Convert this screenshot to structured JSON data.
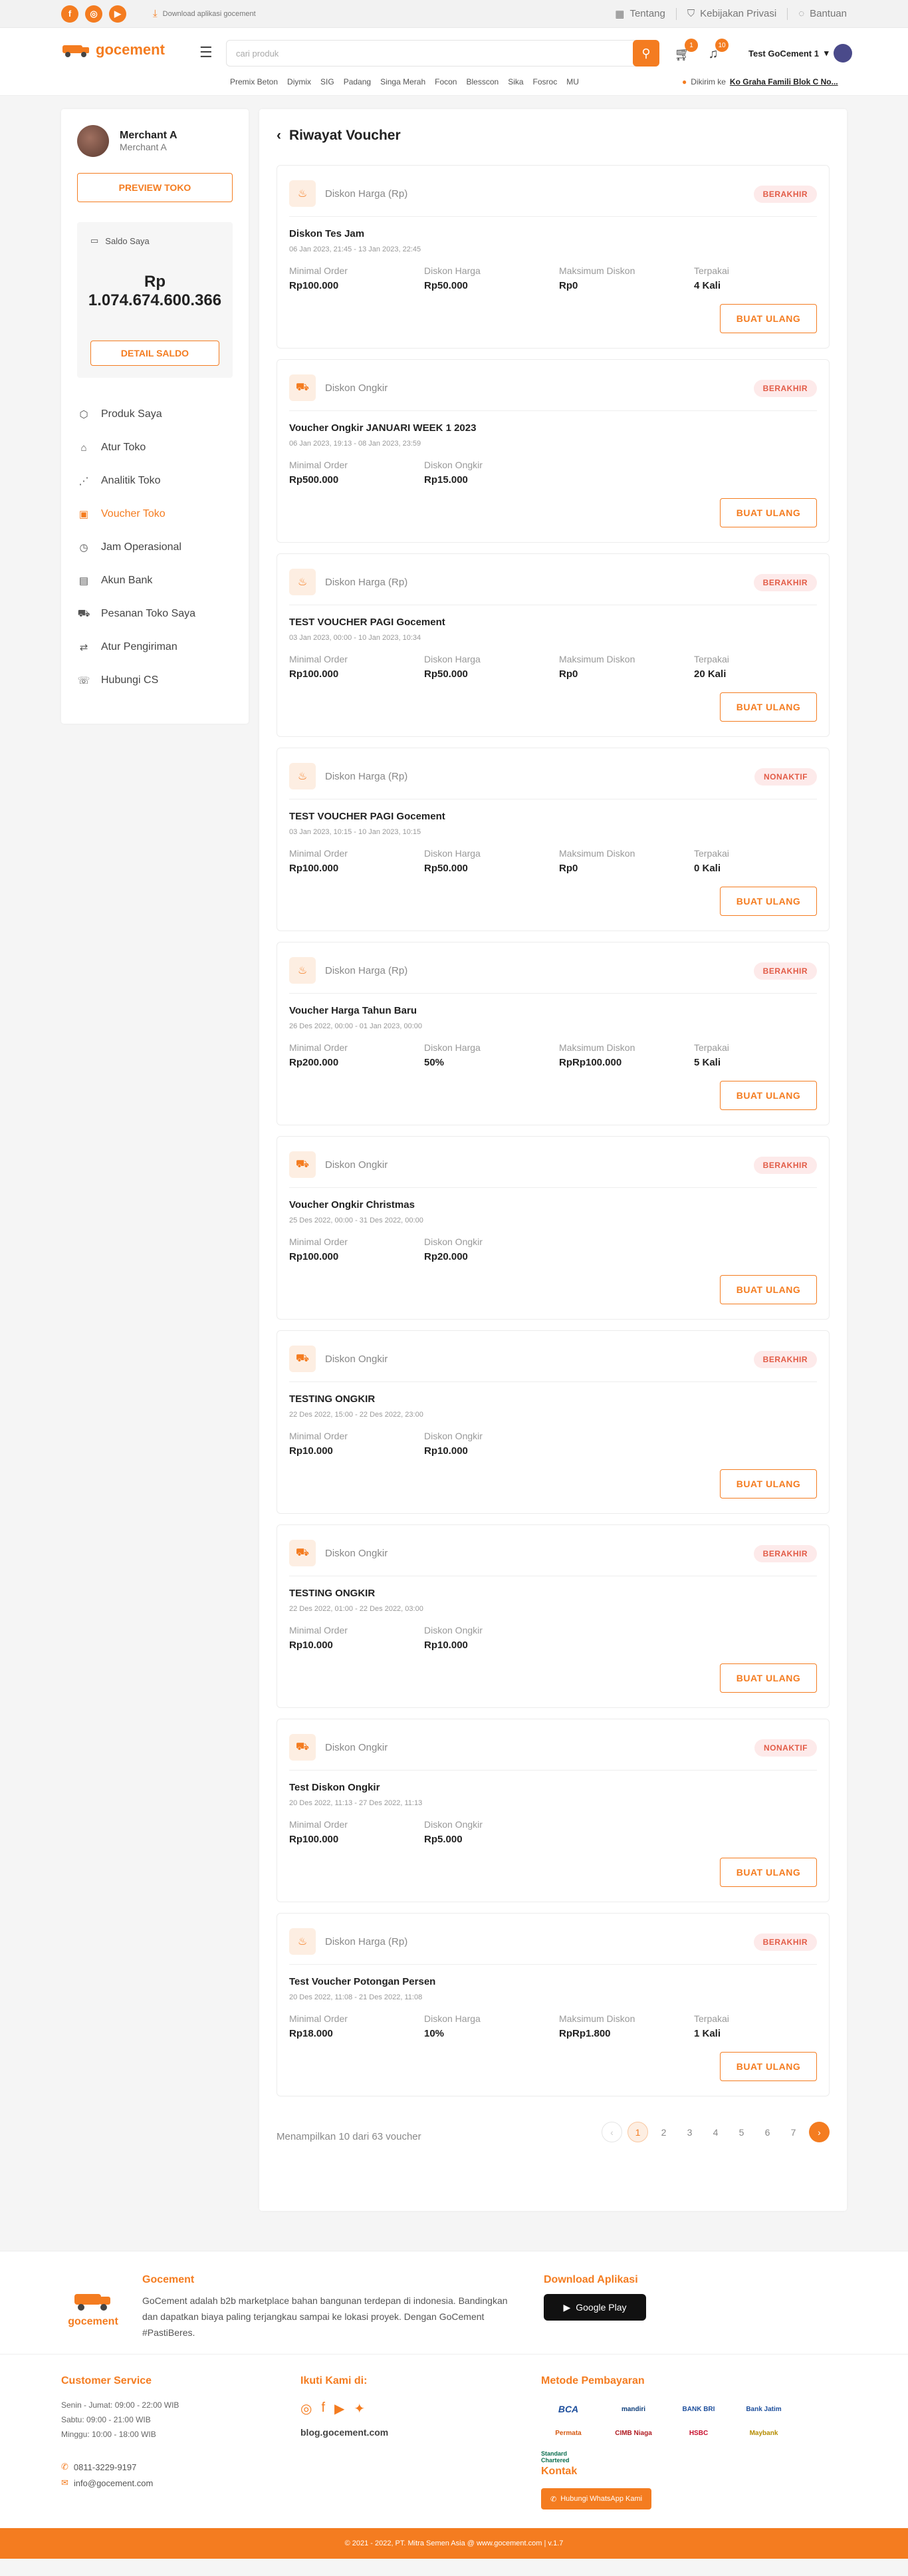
{
  "topbar": {
    "download_text": "Download aplikasi gocement",
    "links": [
      "Tentang",
      "Kebijakan Privasi",
      "Bantuan"
    ]
  },
  "header": {
    "logo_text": "gocement",
    "search_placeholder": "cari produk",
    "cart_count": "1",
    "notif_count": "10",
    "user_name": "Test GoCement 1",
    "categories": [
      "Premix Beton",
      "Diymix",
      "SIG",
      "Padang",
      "Singa Merah",
      "Focon",
      "Blesscon",
      "Sika",
      "Fosroc",
      "MU"
    ],
    "deliver_label": "Dikirim ke",
    "deliver_address": "Ko Graha Famili Blok C No..."
  },
  "sidebar": {
    "merchant_name": "Merchant A",
    "merchant_sub": "Merchant A",
    "preview_label": "PREVIEW TOKO",
    "saldo_label": "Saldo Saya",
    "saldo_value": "Rp 1.074.674.600.366",
    "saldo_button": "DETAIL SALDO",
    "menu": [
      {
        "label": "Produk Saya",
        "icon": "box-icon"
      },
      {
        "label": "Atur Toko",
        "icon": "store-icon"
      },
      {
        "label": "Analitik Toko",
        "icon": "chart-icon"
      },
      {
        "label": "Voucher Toko",
        "icon": "ticket-icon",
        "active": true
      },
      {
        "label": "Jam Operasional",
        "icon": "clock-icon"
      },
      {
        "label": "Akun Bank",
        "icon": "bank-icon"
      },
      {
        "label": "Pesanan Toko Saya",
        "icon": "cart-icon"
      },
      {
        "label": "Atur Pengiriman",
        "icon": "truck-icon"
      },
      {
        "label": "Hubungi CS",
        "icon": "chat-icon"
      }
    ]
  },
  "content": {
    "title": "Riwayat Voucher",
    "rebuild_label": "BUAT ULANG",
    "vouchers": [
      {
        "type": "Diskon Harga (Rp)",
        "kind": "price",
        "status": "BERAKHIR",
        "name": "Diskon Tes Jam",
        "date": "06 Jan 2023, 21:45 - 13 Jan 2023, 22:45",
        "fields": [
          [
            "Minimal Order",
            "Rp100.000"
          ],
          [
            "Diskon Harga",
            "Rp50.000"
          ],
          [
            "Maksimum Diskon",
            "Rp0"
          ],
          [
            "Terpakai",
            "4 Kali"
          ]
        ]
      },
      {
        "type": "Diskon Ongkir",
        "kind": "shipping",
        "status": "BERAKHIR",
        "name": "Voucher Ongkir JANUARI WEEK 1 2023",
        "date": "06 Jan 2023, 19:13 - 08 Jan 2023, 23:59",
        "fields": [
          [
            "Minimal Order",
            "Rp500.000"
          ],
          [
            "Diskon Ongkir",
            "Rp15.000"
          ]
        ]
      },
      {
        "type": "Diskon Harga (Rp)",
        "kind": "price",
        "status": "BERAKHIR",
        "name": "TEST VOUCHER PAGI Gocement",
        "date": "03 Jan 2023, 00:00 - 10 Jan 2023, 10:34",
        "fields": [
          [
            "Minimal Order",
            "Rp100.000"
          ],
          [
            "Diskon Harga",
            "Rp50.000"
          ],
          [
            "Maksimum Diskon",
            "Rp0"
          ],
          [
            "Terpakai",
            "20 Kali"
          ]
        ]
      },
      {
        "type": "Diskon Harga (Rp)",
        "kind": "price",
        "status": "NONAKTIF",
        "name": "TEST VOUCHER PAGI Gocement",
        "date": "03 Jan 2023, 10:15 - 10 Jan 2023, 10:15",
        "fields": [
          [
            "Minimal Order",
            "Rp100.000"
          ],
          [
            "Diskon Harga",
            "Rp50.000"
          ],
          [
            "Maksimum Diskon",
            "Rp0"
          ],
          [
            "Terpakai",
            "0 Kali"
          ]
        ]
      },
      {
        "type": "Diskon Harga (Rp)",
        "kind": "price",
        "status": "BERAKHIR",
        "name": "Voucher Harga Tahun Baru",
        "date": "26 Des 2022, 00:00 - 01 Jan 2023, 00:00",
        "fields": [
          [
            "Minimal Order",
            "Rp200.000"
          ],
          [
            "Diskon Harga",
            "50%"
          ],
          [
            "Maksimum Diskon",
            "RpRp100.000"
          ],
          [
            "Terpakai",
            "5 Kali"
          ]
        ]
      },
      {
        "type": "Diskon Ongkir",
        "kind": "shipping",
        "status": "BERAKHIR",
        "name": "Voucher Ongkir Christmas",
        "date": "25 Des 2022, 00:00 - 31 Des 2022, 00:00",
        "fields": [
          [
            "Minimal Order",
            "Rp100.000"
          ],
          [
            "Diskon Ongkir",
            "Rp20.000"
          ]
        ]
      },
      {
        "type": "Diskon Ongkir",
        "kind": "shipping",
        "status": "BERAKHIR",
        "name": "TESTING ONGKIR",
        "date": "22 Des 2022, 15:00 - 22 Des 2022, 23:00",
        "fields": [
          [
            "Minimal Order",
            "Rp10.000"
          ],
          [
            "Diskon Ongkir",
            "Rp10.000"
          ]
        ]
      },
      {
        "type": "Diskon Ongkir",
        "kind": "shipping",
        "status": "BERAKHIR",
        "name": "TESTING ONGKIR",
        "date": "22 Des 2022, 01:00 - 22 Des 2022, 03:00",
        "fields": [
          [
            "Minimal Order",
            "Rp10.000"
          ],
          [
            "Diskon Ongkir",
            "Rp10.000"
          ]
        ]
      },
      {
        "type": "Diskon Ongkir",
        "kind": "shipping",
        "status": "NONAKTIF",
        "name": "Test Diskon Ongkir",
        "date": "20 Des 2022, 11:13 - 27 Des 2022, 11:13",
        "fields": [
          [
            "Minimal Order",
            "Rp100.000"
          ],
          [
            "Diskon Ongkir",
            "Rp5.000"
          ]
        ]
      },
      {
        "type": "Diskon Harga (Rp)",
        "kind": "price",
        "status": "BERAKHIR",
        "name": "Test Voucher Potongan Persen",
        "date": "20 Des 2022, 11:08 - 21 Des 2022, 11:08",
        "fields": [
          [
            "Minimal Order",
            "Rp18.000"
          ],
          [
            "Diskon Harga",
            "10%"
          ],
          [
            "Maksimum Diskon",
            "RpRp1.800"
          ],
          [
            "Terpakai",
            "1 Kali"
          ]
        ]
      }
    ],
    "pagination_info": "Menampilkan 10 dari 63 voucher",
    "pages": [
      "1",
      "2",
      "3",
      "4",
      "5",
      "6",
      "7"
    ],
    "current_page": "1"
  },
  "footer": {
    "logo_text": "gocement",
    "about_title": "Gocement",
    "about_text": "GoCement adalah b2b marketplace bahan bangunan terdepan di indonesia. Bandingkan dan dapatkan biaya paling terjangkau sampai ke lokasi proyek. Dengan GoCement #PastiBeres.",
    "download_title": "Download Aplikasi",
    "google_play": "Google Play",
    "cs_title": "Customer Service",
    "cs_hours": [
      "Senin - Jumat: 09:00 - 22:00 WIB",
      "Sabtu: 09:00 - 21:00 WIB",
      "Minggu: 10:00 - 18:00 WIB"
    ],
    "phone": "0811-3229-9197",
    "email": "info@gocement.com",
    "follow_title": "Ikuti Kami di:",
    "blog": "blog.gocement.com",
    "payment_title": "Metode Pembayaran",
    "payments": [
      "BCA",
      "mandiri",
      "BANK BRI",
      "Bank Jatim",
      "Permata",
      "CIMB Niaga",
      "HSBC",
      "Maybank",
      "Standard Chartered"
    ],
    "contact_title": "Kontak",
    "whatsapp": "Hubungi WhatsApp Kami",
    "copyright": "© 2021 - 2022, PT. Mitra Semen Asia @ www.gocement.com | v.1.7"
  }
}
